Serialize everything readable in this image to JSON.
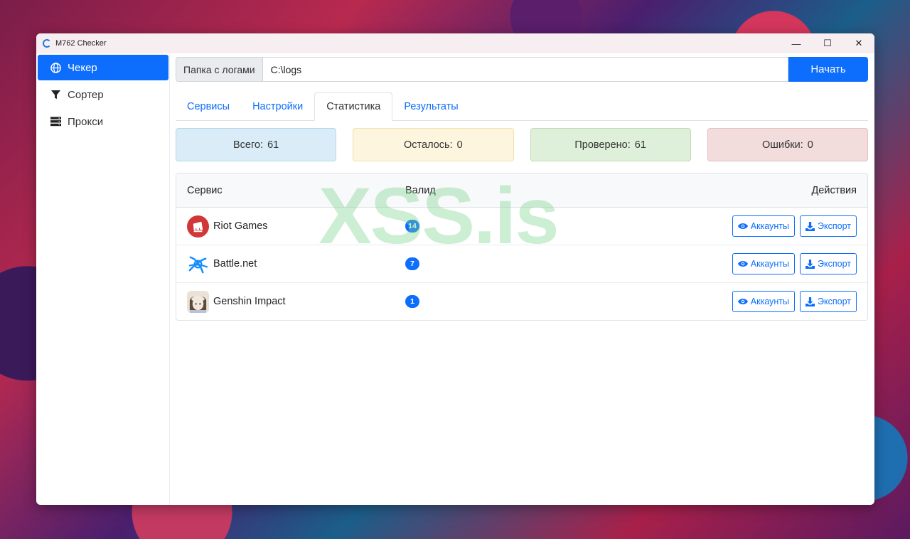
{
  "window": {
    "title": "M762 Checker",
    "controls": [
      "—",
      "☐",
      "✕"
    ]
  },
  "sidebar": {
    "items": [
      {
        "label": "Чекер",
        "icon": "globe-icon",
        "active": true
      },
      {
        "label": "Сортер",
        "icon": "filter-icon",
        "active": false
      },
      {
        "label": "Прокси",
        "icon": "server-icon",
        "active": false
      }
    ]
  },
  "folder": {
    "label": "Папка с логами",
    "value": "C:\\logs",
    "start_button": "Начать"
  },
  "tabs": [
    {
      "label": "Сервисы",
      "active": false
    },
    {
      "label": "Настройки",
      "active": false
    },
    {
      "label": "Статистика",
      "active": true
    },
    {
      "label": "Результаты",
      "active": false
    }
  ],
  "stats": [
    {
      "label": "Всего:",
      "value": "61",
      "bg": "#d9ecf7",
      "border": "#b7d7ea"
    },
    {
      "label": "Осталось:",
      "value": "0",
      "bg": "#fdf5dd",
      "border": "#f1e2b0"
    },
    {
      "label": "Проверено:",
      "value": "61",
      "bg": "#def0d9",
      "border": "#bedcb5"
    },
    {
      "label": "Ошибки:",
      "value": "0",
      "bg": "#f2dcdc",
      "border": "#e4c0c0"
    }
  ],
  "table": {
    "headers": {
      "service": "Сервис",
      "valid": "Валид",
      "actions": "Действия"
    },
    "rows": [
      {
        "name": "Riot Games",
        "valid": "14",
        "icon": "riot-games-icon"
      },
      {
        "name": "Battle.net",
        "valid": "7",
        "icon": "battlenet-icon"
      },
      {
        "name": "Genshin Impact",
        "valid": "1",
        "icon": "genshin-impact-icon"
      }
    ],
    "accounts_label": "Аккаунты",
    "export_label": "Экспорт"
  },
  "watermark": "XSS.is",
  "colors": {
    "accent": "#0d6efd"
  }
}
